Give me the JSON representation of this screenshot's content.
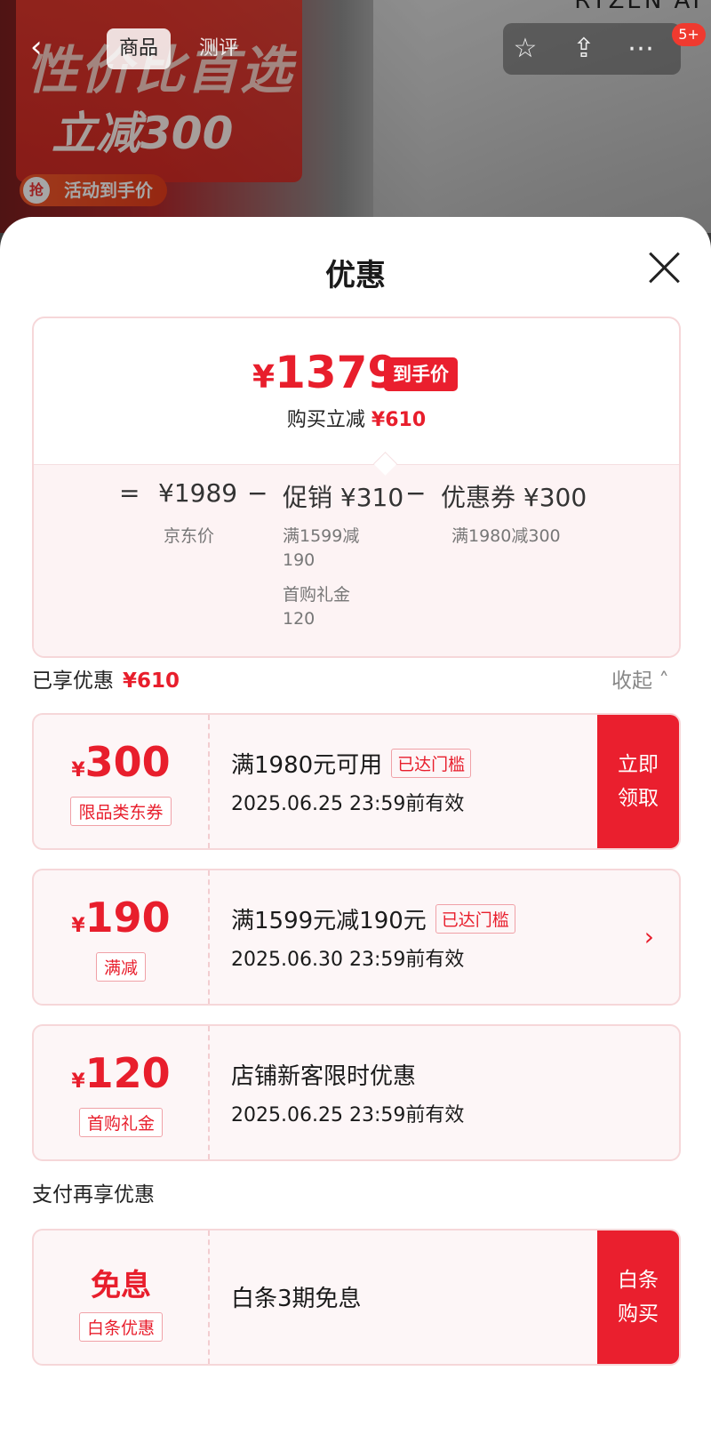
{
  "banner": {
    "promo_big": "性价比首选",
    "promo_sub": "立减300",
    "promo_tag_icon": "抢",
    "promo_tag": "活动到手价",
    "brand_text": "RYZEN AI"
  },
  "nav": {
    "tabs": [
      "商品",
      "测评"
    ],
    "badge": "5+"
  },
  "sheet": {
    "title": "优惠",
    "price": {
      "yen": "¥",
      "final": "1379",
      "final_tag": "到手价",
      "save_label": "购买立减",
      "save_amount": "¥610"
    },
    "formula": {
      "equals": "=",
      "jd_price": "¥1989",
      "jd_label": "京东价",
      "minus1": "−",
      "promo": "促销 ¥310",
      "promo_sub1": "满1599减",
      "promo_sub2": "190",
      "promo_sub3": "首购礼金",
      "promo_sub4": "120",
      "minus2": "−",
      "coupon": "优惠券 ¥300",
      "coupon_sub": "满1980减300"
    },
    "enjoyed_label": "已享优惠",
    "enjoyed_amount": "¥610",
    "collapse": "收起",
    "coupons": [
      {
        "yen": "¥",
        "amount": "300",
        "badge": "限品类东券",
        "title": "满1980元可用",
        "threshold": "已达门槛",
        "valid": "2025.06.25 23:59前有效",
        "cta_line1": "立即",
        "cta_line2": "领取"
      },
      {
        "yen": "¥",
        "amount": "190",
        "badge": "满减",
        "title": "满1599元减190元",
        "threshold": "已达门槛",
        "valid": "2025.06.30 23:59前有效"
      },
      {
        "yen": "¥",
        "amount": "120",
        "badge": "首购礼金",
        "title": "店铺新客限时优惠",
        "valid": "2025.06.25 23:59前有效"
      }
    ],
    "pay_label": "支付再享优惠",
    "pay_coupon": {
      "word": "免息",
      "badge": "白条优惠",
      "title": "白条3期免息",
      "cta_line1": "白条",
      "cta_line2": "购买"
    }
  },
  "colors": {
    "accent": "#EA1F2E",
    "card_border": "#F6D7D9",
    "card_bg": "#FDF6F7"
  }
}
